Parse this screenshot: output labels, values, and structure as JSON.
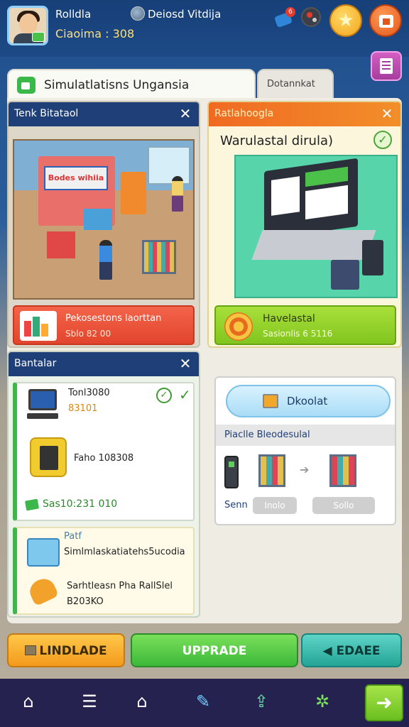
{
  "player": {
    "name": "Rolldla",
    "cash": "Ciaoima : 308"
  },
  "server": {
    "name": "Deiosd Vitdija"
  },
  "notification_count": "6",
  "tabs": {
    "main": "Simulatlatisns Ungansia",
    "secondary": "Dotannkat"
  },
  "store_card": {
    "title": "Tenk Bitataol",
    "sign": "Bodes wihiia",
    "bar_title": "Pekosestons laorttan",
    "bar_sub": "Sblo 82 00"
  },
  "computer_card": {
    "title": "Ratlahoogla",
    "heading": "Warulastal dirula)",
    "bar_title": "Havelastal",
    "bar_sub": "Sasionlis 6 5116"
  },
  "stations_card": {
    "title": "Bantalar",
    "item1_name": "Tonl3080",
    "item1_value": "83101",
    "item2_name": "Faho 108308",
    "item3_value": "Sas10:231 010",
    "item4_header": "Patf",
    "item4_name": "Simlmlaskatiatehs5ucodia",
    "item5_name": "Sarhtleasn Pha RallSlel",
    "item5_value": "B203KO"
  },
  "flow_card": {
    "tag_label": "Dkoolat",
    "subheader": "Piaclle Bleodesulal",
    "label_left": "Senn",
    "btn_mid": "Inolo",
    "btn_right": "Sollo"
  },
  "actions": {
    "upload": "LINDLADE",
    "upgrade": "UPPRADE",
    "trade": "EDAEE"
  },
  "colors": {
    "header_navy": "#1f3f78",
    "orange_header": "#f06a22",
    "upgrade_green": "#3cb83a",
    "upload_yellow": "#f39a1c",
    "trade_teal": "#23a596",
    "nav_bg": "#25224f"
  }
}
